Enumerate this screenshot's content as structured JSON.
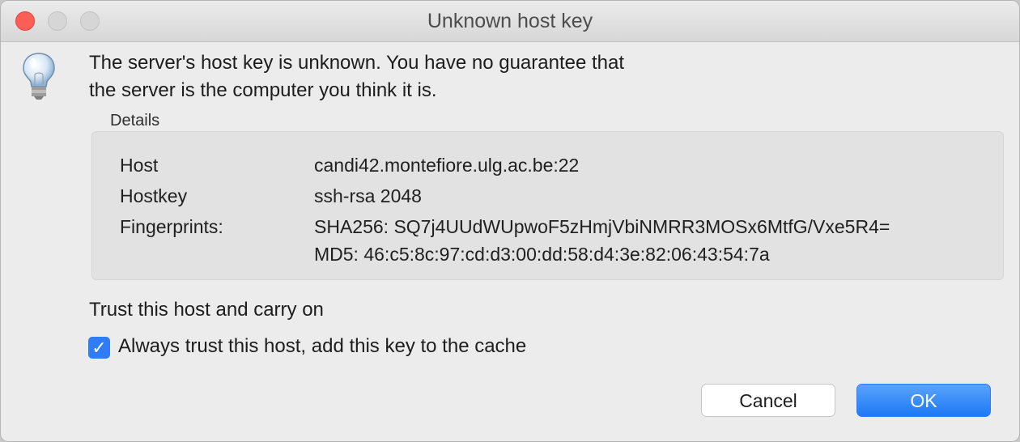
{
  "window": {
    "title": "Unknown host key"
  },
  "icons": {
    "dialog_icon": "lightbulb-icon",
    "checkbox": "checkmark-icon"
  },
  "message": {
    "line1": "The server's host key is unknown. You have no guarantee that",
    "line2": "the server is the computer you think it is."
  },
  "details": {
    "label": "Details",
    "rows": [
      {
        "label": "Host",
        "value": "candi42.montefiore.ulg.ac.be:22"
      },
      {
        "label": "Hostkey",
        "value": "ssh-rsa 2048"
      },
      {
        "label": "Fingerprints:",
        "value": "SHA256: SQ7j4UUdWUpwoF5zHmjVbiNMRR3MOSx6MtfG/Vxe5R4="
      },
      {
        "label": "",
        "value": "MD5: 46:c5:8c:97:cd:d3:00:dd:58:d4:3e:82:06:43:54:7a"
      }
    ]
  },
  "trust": {
    "heading": "Trust this host and carry on",
    "checkbox_label": "Always trust this host, add this key to the cache",
    "checkbox_checked": true,
    "checkmark": "✓"
  },
  "buttons": {
    "cancel": "Cancel",
    "ok": "OK"
  },
  "colors": {
    "accent": "#2f7cf6",
    "close": "#fd5f57"
  }
}
